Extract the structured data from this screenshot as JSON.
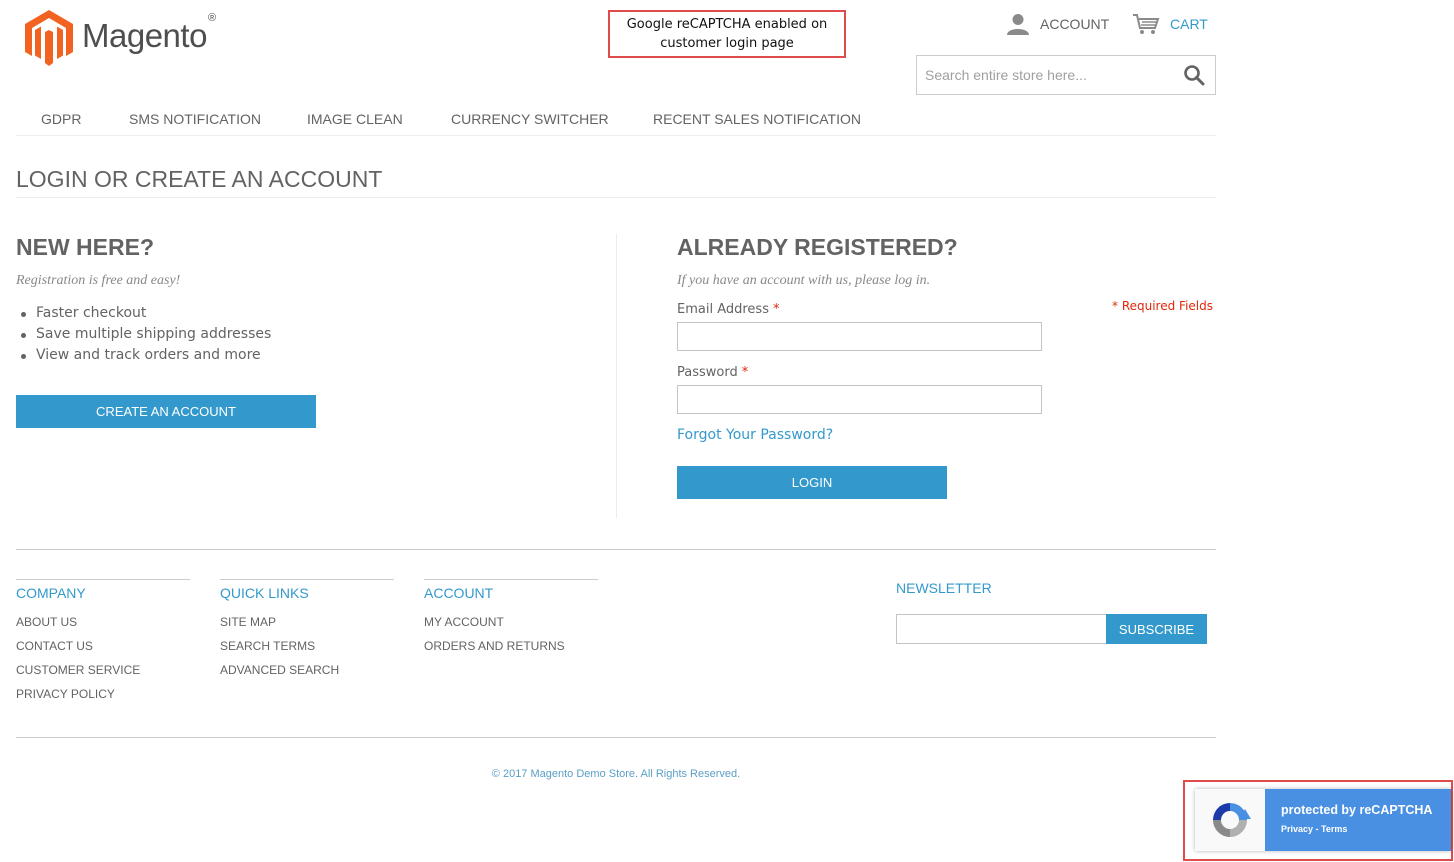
{
  "header": {
    "logo_text": "Magento",
    "logo_mark": "®",
    "account_label": "ACCOUNT",
    "cart_label": "CART",
    "search_placeholder": "Search entire store here..."
  },
  "annotation_top": {
    "line1": "Google reCAPTCHA enabled on",
    "line2": "customer login page"
  },
  "nav": {
    "items": [
      "GDPR",
      "SMS NOTIFICATION",
      "IMAGE CLEAN",
      "CURRENCY SWITCHER",
      "RECENT SALES NOTIFICATION"
    ]
  },
  "page": {
    "title": "LOGIN OR CREATE AN ACCOUNT"
  },
  "new_customer": {
    "title": "NEW HERE?",
    "subtitle": "Registration is free and easy!",
    "benefits": [
      "Faster checkout",
      "Save multiple shipping addresses",
      "View and track orders and more"
    ],
    "button_label": "CREATE AN ACCOUNT"
  },
  "login": {
    "title": "ALREADY REGISTERED?",
    "subtitle": "If you have an account with us, please log in.",
    "required_note": "* Required Fields",
    "email_label": "Email Address",
    "password_label": "Password",
    "required_mark": "*",
    "email_value": "",
    "password_value": "",
    "forgot_label": "Forgot Your Password?",
    "button_label": "LOGIN"
  },
  "footer": {
    "columns": [
      {
        "title": "COMPANY",
        "links": [
          "ABOUT US",
          "CONTACT US",
          "CUSTOMER SERVICE",
          "PRIVACY POLICY"
        ]
      },
      {
        "title": "QUICK LINKS",
        "links": [
          "SITE MAP",
          "SEARCH TERMS",
          "ADVANCED SEARCH"
        ]
      },
      {
        "title": "ACCOUNT",
        "links": [
          "MY ACCOUNT",
          "ORDERS AND RETURNS"
        ]
      }
    ],
    "newsletter_title": "NEWSLETTER",
    "subscribe_label": "SUBSCRIBE",
    "copyright": "© 2017 Magento Demo Store. All Rights Reserved."
  },
  "recaptcha": {
    "title": "protected by reCAPTCHA",
    "privacy": "Privacy",
    "separator": " - ",
    "terms": "Terms"
  },
  "colors": {
    "accent": "#3399cc",
    "brand_orange": "#f26322",
    "required": "#df280a",
    "annotation_border": "#e04b4b",
    "recaptcha_blue": "#4a90e2"
  },
  "icons": [
    "magento-logo-icon",
    "account-icon",
    "cart-icon",
    "search-icon",
    "recaptcha-icon"
  ]
}
